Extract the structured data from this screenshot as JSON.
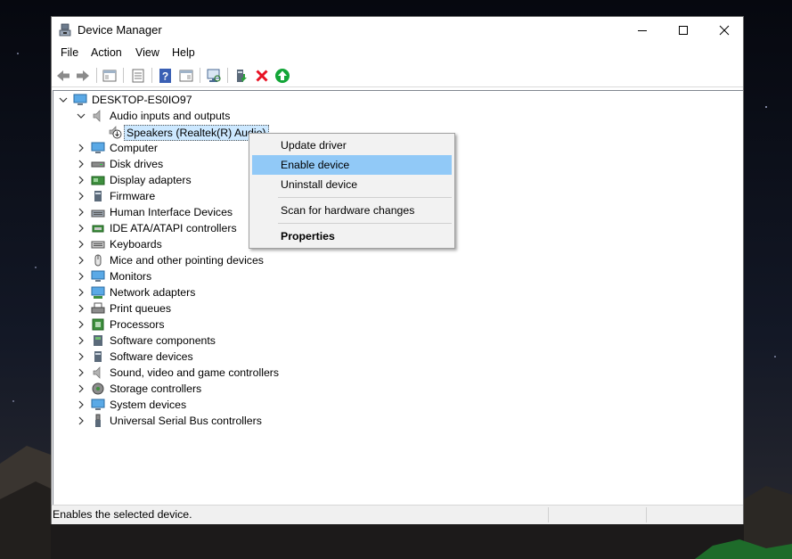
{
  "window": {
    "title": "Device Manager"
  },
  "menu": [
    "File",
    "Action",
    "View",
    "Help"
  ],
  "toolbar": {
    "icons": [
      "back-arrow-icon",
      "forward-arrow-icon",
      "show-hide-tree-icon",
      "properties-icon",
      "help-icon",
      "action-pane-icon",
      "scan-monitor-icon",
      "update-driver-icon",
      "uninstall-icon",
      "enable-device-icon"
    ]
  },
  "tree": {
    "root": "DESKTOP-ES0IO97",
    "expanded_category": "Audio inputs and outputs",
    "selected_device": "Speakers (Realtek(R) Audio)",
    "categories": [
      "Computer",
      "Disk drives",
      "Display adapters",
      "Firmware",
      "Human Interface Devices",
      "IDE ATA/ATAPI controllers",
      "Keyboards",
      "Mice and other pointing devices",
      "Monitors",
      "Network adapters",
      "Print queues",
      "Processors",
      "Software components",
      "Software devices",
      "Sound, video and game controllers",
      "Storage controllers",
      "System devices",
      "Universal Serial Bus controllers"
    ]
  },
  "context_menu": {
    "update_driver": "Update driver",
    "enable_device": "Enable device",
    "uninstall_device": "Uninstall device",
    "scan": "Scan for hardware changes",
    "properties": "Properties"
  },
  "status": {
    "text": "Enables the selected device."
  },
  "colors": {
    "selection": "#cce8ff",
    "menu_highlight": "#91c9f7",
    "error_red": "#e81123",
    "enable_green": "#12a537"
  }
}
